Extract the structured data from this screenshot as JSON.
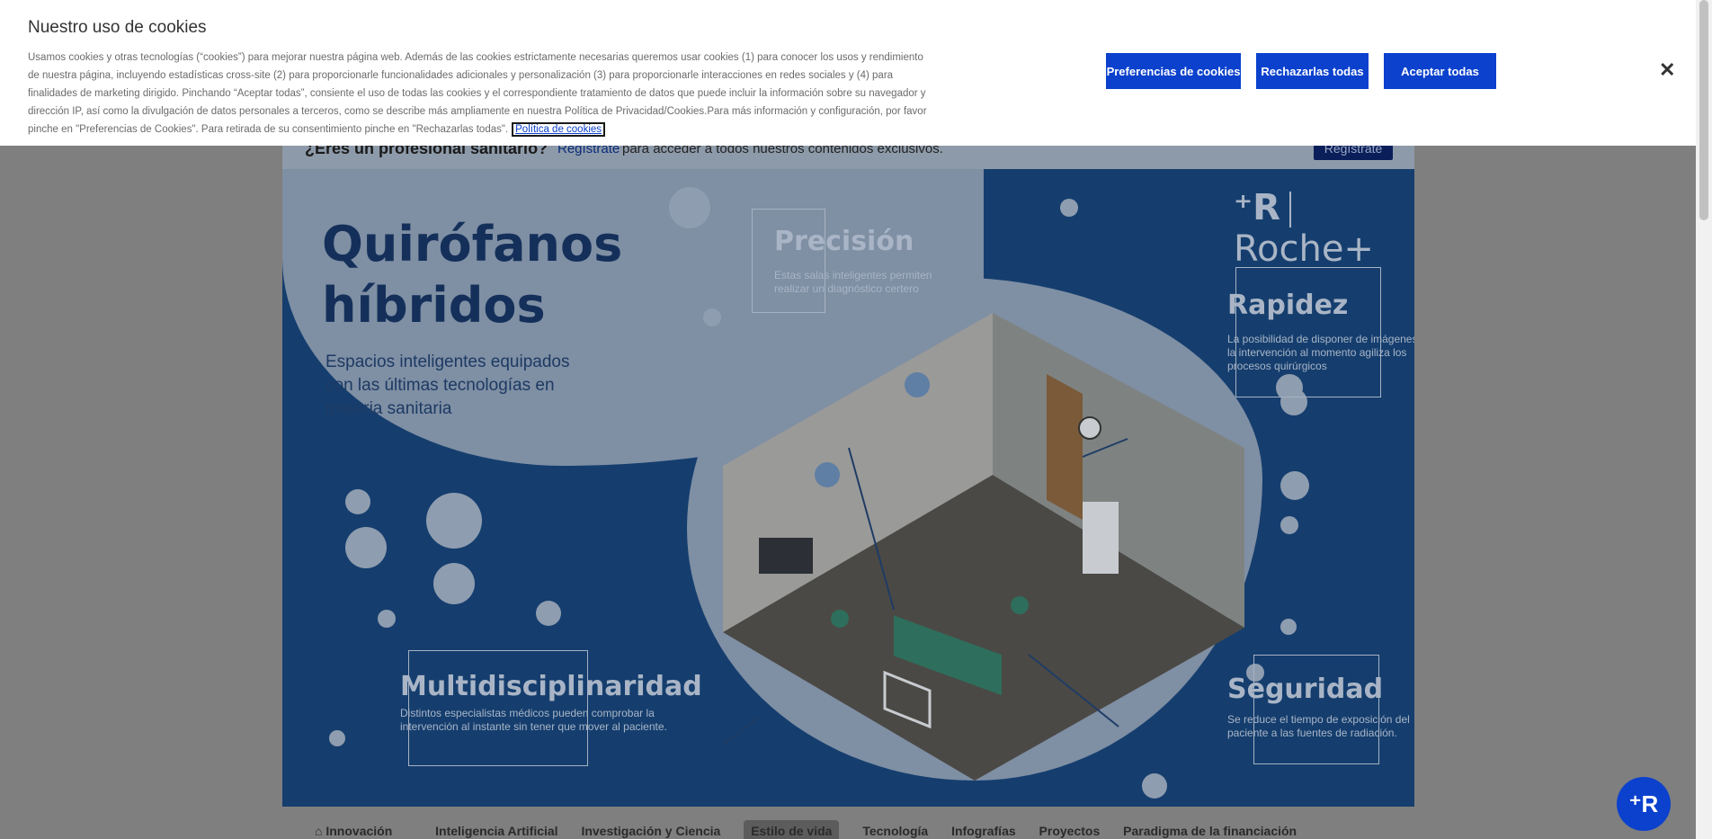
{
  "cookie_banner": {
    "title": "Nuestro uso de cookies",
    "body": "Usamos cookies y otras tecnologías (“cookies”) para mejorar nuestra página web. Además de las cookies estrictamente necesarias queremos usar cookies (1) para conocer los usos y rendimiento de nuestra página, incluyendo estadísticas cross-site (2) para proporcionarle funcionalidades adicionales y personalización (3) para proporcionarle interacciones en redes sociales y (4) para finalidades de marketing dirigido. Pinchando “Aceptar todas”, consiente el uso de todas las cookies y el correspondiente tratamiento de datos que puede incluir la información sobre su navegador y dirección IP, así como la divulgación de datos personales a terceros, como se describe más ampliamente en nuestra Política de Privacidad/Cookies.Para más información y configuración, por favor pinche en \"Preferencias de Cookies\". Para retirada de su consentimiento pinche en \"Rechazarlas todas\".",
    "policy_link": "Política de cookies",
    "preferences_label": "Preferencias de cookies",
    "reject_label": "Rechazarlas todas",
    "accept_label": "Aceptar todas",
    "close_icon": "close-icon"
  },
  "pro_bar": {
    "title": "¿Eres un profesional sanitario?",
    "link": "Regístrate",
    "rest": "para acceder a todos nuestros contenidos exclusivos.",
    "button": "Regístrate"
  },
  "hero": {
    "title_line1": "Quirófanos",
    "title_line2": "híbridos",
    "subtitle": "Espacios inteligentes equipados con las últimas tecnologías en materia sanitaria",
    "brand_name": "Roche+",
    "cards": {
      "precision": {
        "title": "Precisión",
        "text": "Estas salas inteligentes permiten realizar un diagnóstico certero"
      },
      "rapidez": {
        "title": "Rapidez",
        "text": "La posibilidad de disponer de imágenes de la intervención al momento agiliza los procesos quirúrgicos"
      },
      "multi": {
        "title": "Multidisciplinaridad",
        "text": "Distintos especialistas médicos pueden comprobar la intervención al instante sin tener que mover al paciente."
      },
      "seguridad": {
        "title": "Seguridad",
        "text": "Se reduce el tiempo de exposición del paciente a las fuentes de radiación."
      }
    }
  },
  "tabs": [
    "Innovación",
    "Inteligencia Artificial",
    "Investigación y Ciencia",
    "Estilo de vida",
    "Tecnología",
    "Infografías",
    "Proyectos",
    "Paradigma de la financiación"
  ],
  "colors": {
    "accent": "#0b41cd",
    "hero_bg": "#153e6e"
  }
}
